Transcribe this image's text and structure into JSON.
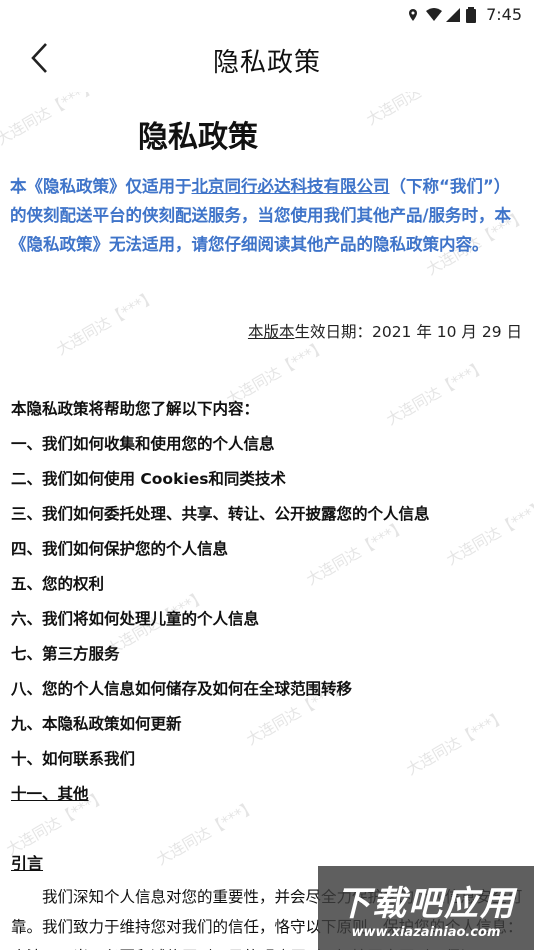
{
  "status_bar": {
    "time": "7:45"
  },
  "header": {
    "title": "隐私政策"
  },
  "document": {
    "title": "隐私政策",
    "intro_prefix": "本《隐私政策》仅适用于",
    "intro_company": "北京同行必达科技有限公司",
    "intro_rest": "（下称“我们”）的侠刻配送平台的侠刻配送服务，当您使用我们其他产品/服务时，本《隐私政策》无法适用，请您仔细阅读其他产品的隐私政策内容。",
    "effective_prefix": "本版本",
    "effective_rest": "生效日期：2021 年 10 月 29 日",
    "toc_intro": "本隐私政策将帮助您了解以下内容：",
    "toc": [
      "一、我们如何收集和使用您的个人信息",
      "二、我们如何使用 Cookies和同类技术",
      "三、我们如何委托处理、共享、转让、公开披露您的个人信息",
      "四、我们如何保护您的个人信息",
      "五、您的权利",
      "六、我们将如何处理儿童的个人信息",
      "七、第三方服务",
      "八、您的个人信息如何储存及如何在全球范围转移",
      "九、本隐私政策如何更新",
      "十、如何联系我们",
      "十一、其他"
    ],
    "section_title": "引言",
    "paragraph": "我们深知个人信息对您的重要性，并会尽全力保护您的个人信息安全可靠。我们致力于维持您对我们的信任，恪守以下原则，保护您的个人信息：合法、正当、必要和诚信原则、目的明确原则、知情同意原则、保证"
  },
  "watermark": {
    "text": "大连同达【***】"
  },
  "site_logo": {
    "big": "下载吧应用",
    "small": "www.xiazainiao.com"
  }
}
